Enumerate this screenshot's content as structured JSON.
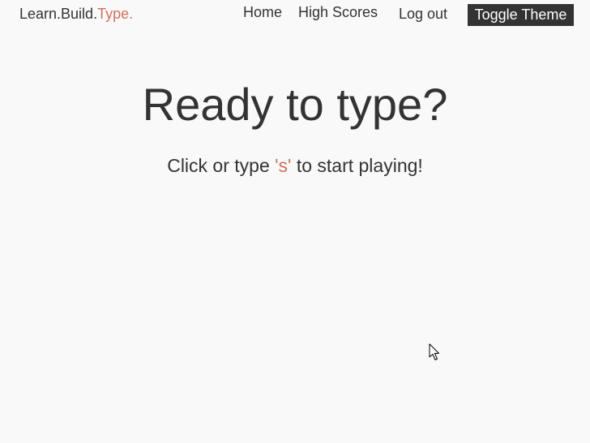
{
  "header": {
    "logo": {
      "part1": "Learn.Build.",
      "part2": "Type."
    },
    "nav": {
      "home": "Home",
      "high_scores": "High Scores",
      "logout": "Log out"
    },
    "toggle_theme": "Toggle Theme"
  },
  "main": {
    "headline": "Ready to type?",
    "instruction": {
      "before": "Click or type ",
      "key": "'s'",
      "after": " to start playing!"
    }
  },
  "colors": {
    "background": "#f9f9f9",
    "text": "#333333",
    "accent": "#d0705c",
    "button_bg": "#333333",
    "button_text": "#ffffff"
  },
  "icons": {
    "cursor": "mouse-pointer-icon"
  }
}
